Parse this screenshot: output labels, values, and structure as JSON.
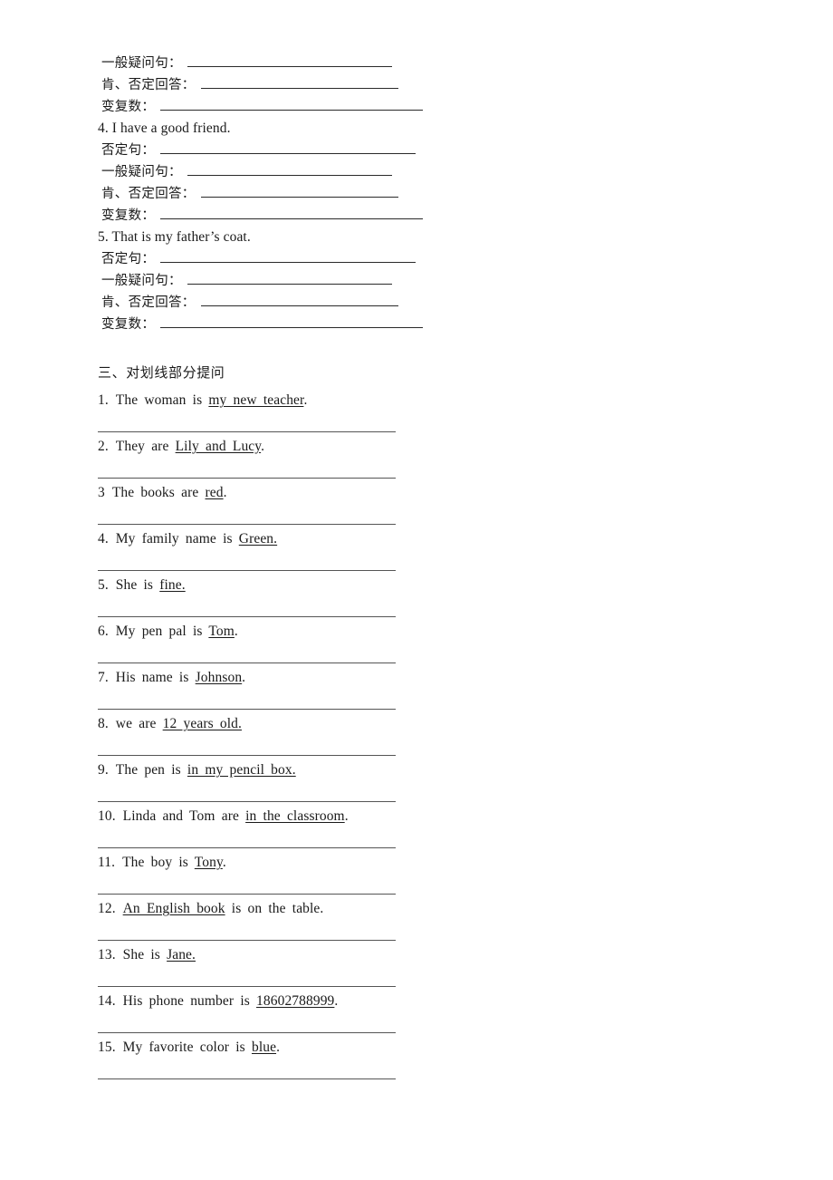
{
  "document": {
    "background_color": "#ffffff",
    "text_color": "#1a1a1a",
    "rule_color": "#2a2a2a"
  },
  "section_two_continued": {
    "labels": {
      "general_question": "一般疑问句：",
      "affirm_negative_answer": "肯、否定回答：",
      "plural": "变复数：",
      "negative_sentence": "否定句："
    },
    "leading_rows": [
      {
        "label": "一般疑问句：",
        "blank": "w1"
      },
      {
        "label": "肯、否定回答：",
        "blank": "w2"
      },
      {
        "label": "变复数：",
        "blank": "w3"
      }
    ],
    "items": [
      {
        "number": "4.",
        "sentence": "4. I have a good friend.",
        "rows": [
          {
            "label": "否定句：",
            "blank": "w4"
          },
          {
            "label": "一般疑问句：",
            "blank": "w1"
          },
          {
            "label": "肯、否定回答：",
            "blank": "w2"
          },
          {
            "label": "变复数：",
            "blank": "w3"
          }
        ]
      },
      {
        "number": "5.",
        "sentence": "5. That is my father’s coat.",
        "rows": [
          {
            "label": "否定句：",
            "blank": "w4"
          },
          {
            "label": "一般疑问句：",
            "blank": "w1"
          },
          {
            "label": "肯、否定回答：",
            "blank": "w2"
          },
          {
            "label": "变复数：",
            "blank": "w3"
          }
        ]
      }
    ]
  },
  "section_three": {
    "heading": "三、对划线部分提问",
    "questions": [
      {
        "num": "1.",
        "before": "The  woman  is  ",
        "underlined": "my  new  teacher",
        "after": "."
      },
      {
        "num": "2.",
        "before": "They  are  ",
        "underlined": "Lily  and  Lucy",
        "after": "."
      },
      {
        "num": "3",
        "before": "The  books  are  ",
        "underlined": "red",
        "after": "."
      },
      {
        "num": "4.",
        "before": "My  family  name  is  ",
        "underlined": "Green.",
        "after": ""
      },
      {
        "num": "5.",
        "before": "She  is  ",
        "underlined": "fine.",
        "after": ""
      },
      {
        "num": "6.",
        "before": "My  pen  pal  is  ",
        "underlined": "Tom",
        "after": "."
      },
      {
        "num": "7.",
        "before": "His  name  is  ",
        "underlined": "Johnson",
        "after": "."
      },
      {
        "num": "8.",
        "before": "we  are   ",
        "underlined": "12  years  old.",
        "after": ""
      },
      {
        "num": "9.",
        "before": "The  pen  is  ",
        "underlined": "in  my  pencil  box.",
        "after": ""
      },
      {
        "num": "10.",
        "before": "Linda  and  Tom  are  ",
        "underlined": "in  the  classroom",
        "after": "."
      },
      {
        "num": "11.",
        "before": "The  boy  is  ",
        "underlined": "Tony",
        "after": "."
      },
      {
        "num": "12.",
        "before": "",
        "underlined": "An  English  book",
        "after": "  is  on  the  table."
      },
      {
        "num": "13.",
        "before": "She  is  ",
        "underlined": "Jane.",
        "after": ""
      },
      {
        "num": "14.",
        "before": "His  phone  number  is  ",
        "underlined": "18602788999",
        "after": "."
      },
      {
        "num": "15.",
        "before": "My  favorite  color  is  ",
        "underlined": "blue",
        "after": "."
      }
    ]
  }
}
